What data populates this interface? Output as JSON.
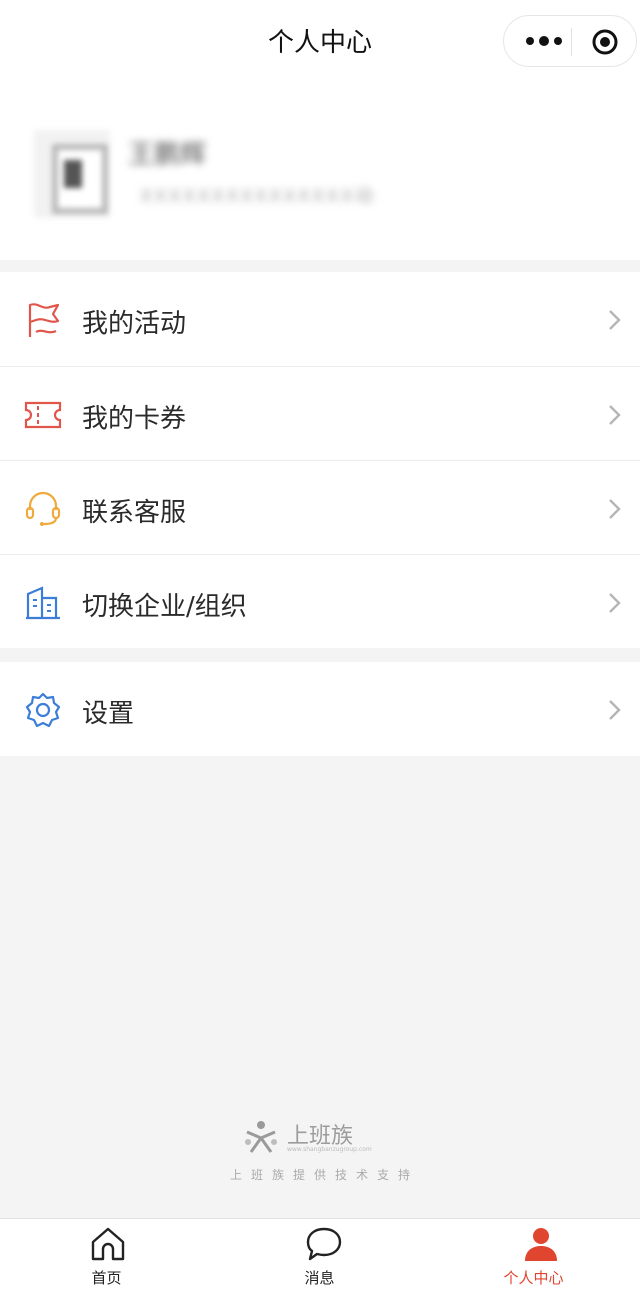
{
  "header": {
    "title": "个人中心",
    "more_icon": "more-dots-icon",
    "close_icon": "target-circle-icon"
  },
  "profile": {
    "name": "王鹏辉",
    "description": "XXXXXXXXXXXXXXX动"
  },
  "menu": [
    {
      "label": "我的活动",
      "icon": "flag-icon",
      "color": "#e0564a"
    },
    {
      "label": "我的卡券",
      "icon": "ticket-icon",
      "color": "#e0564a"
    },
    {
      "label": "联系客服",
      "icon": "headset-icon",
      "color": "#f0a93b"
    },
    {
      "label": "切换企业/组织",
      "icon": "building-icon",
      "color": "#3b7dd8"
    }
  ],
  "settings": {
    "label": "设置",
    "icon": "gear-icon",
    "color": "#3b7dd8"
  },
  "footer": {
    "brand": "上班族",
    "url": "www.shangbanzugroup.com",
    "support": "上班族提供技术支持"
  },
  "tabs": [
    {
      "label": "首页",
      "icon": "home-icon",
      "active": false
    },
    {
      "label": "消息",
      "icon": "chat-bubble-icon",
      "active": false
    },
    {
      "label": "个人中心",
      "icon": "user-icon",
      "active": true
    }
  ],
  "colors": {
    "accent": "#e0452f",
    "background": "#f4f4f4"
  }
}
